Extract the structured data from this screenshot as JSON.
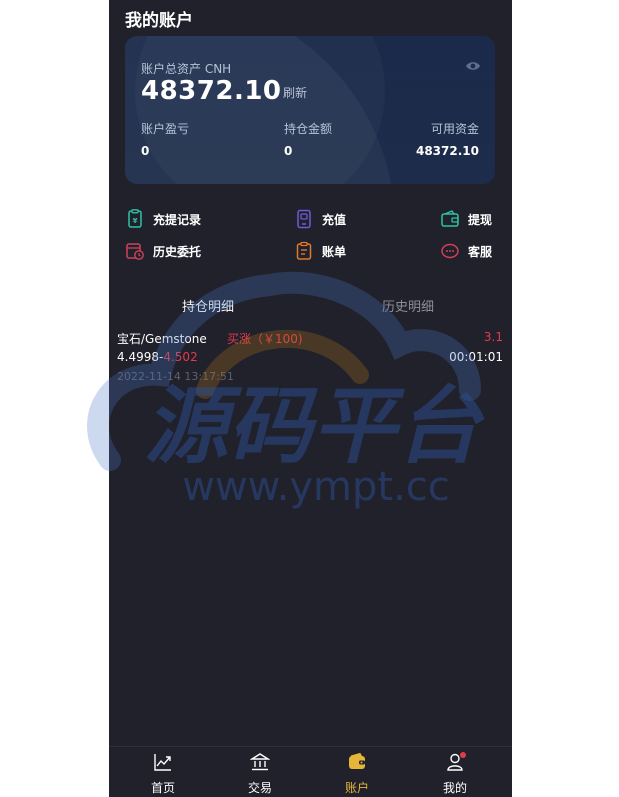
{
  "page": {
    "title": "我的账户"
  },
  "card": {
    "assets_label": "账户总资产 CNH",
    "assets_value": "48372.10",
    "refresh_label": "刷新",
    "pl_label": "账户盈亏",
    "pl_value": "0",
    "position_label": "持仓金额",
    "position_value": "0",
    "available_label": "可用资金",
    "available_value": "48372.10"
  },
  "actions": [
    {
      "label": "充提记录",
      "icon": "wallet-record-icon",
      "color": "#2ec4a6"
    },
    {
      "label": "充值",
      "icon": "phone-deposit-icon",
      "color": "#6a5bd8"
    },
    {
      "label": "提现",
      "icon": "wallet-withdraw-icon",
      "color": "#2ec4a6"
    },
    {
      "label": "历史委托",
      "icon": "calendar-clock-icon",
      "color": "#d0415b"
    },
    {
      "label": "账单",
      "icon": "clipboard-bill-icon",
      "color": "#e07a2c"
    },
    {
      "label": "客服",
      "icon": "chat-support-icon",
      "color": "#d0415b"
    }
  ],
  "tabs": [
    {
      "label": "持仓明细",
      "active": true
    },
    {
      "label": "历史明细",
      "active": false
    }
  ],
  "position": {
    "pair": "宝石/Gemstone",
    "direction": "买涨（￥100)",
    "pnl": "3.1",
    "price_from": "4.4998",
    "price_sep": "-",
    "price_to": "4.502",
    "countdown": "00:01:01",
    "timestamp": "2022-11-14 13:17:51"
  },
  "watermark": {
    "title": "源码平台",
    "url": "www.ympt.cc"
  },
  "nav": [
    {
      "label": "首页",
      "icon": "chart-trend-icon"
    },
    {
      "label": "交易",
      "icon": "bank-icon"
    },
    {
      "label": "账户",
      "icon": "wallet-icon",
      "active": true
    },
    {
      "label": "我的",
      "icon": "user-icon"
    }
  ],
  "colors": {
    "accent": "#e6b63a",
    "up": "#e23b4b",
    "bg": "#20212b",
    "card": "#1c2b4a"
  }
}
